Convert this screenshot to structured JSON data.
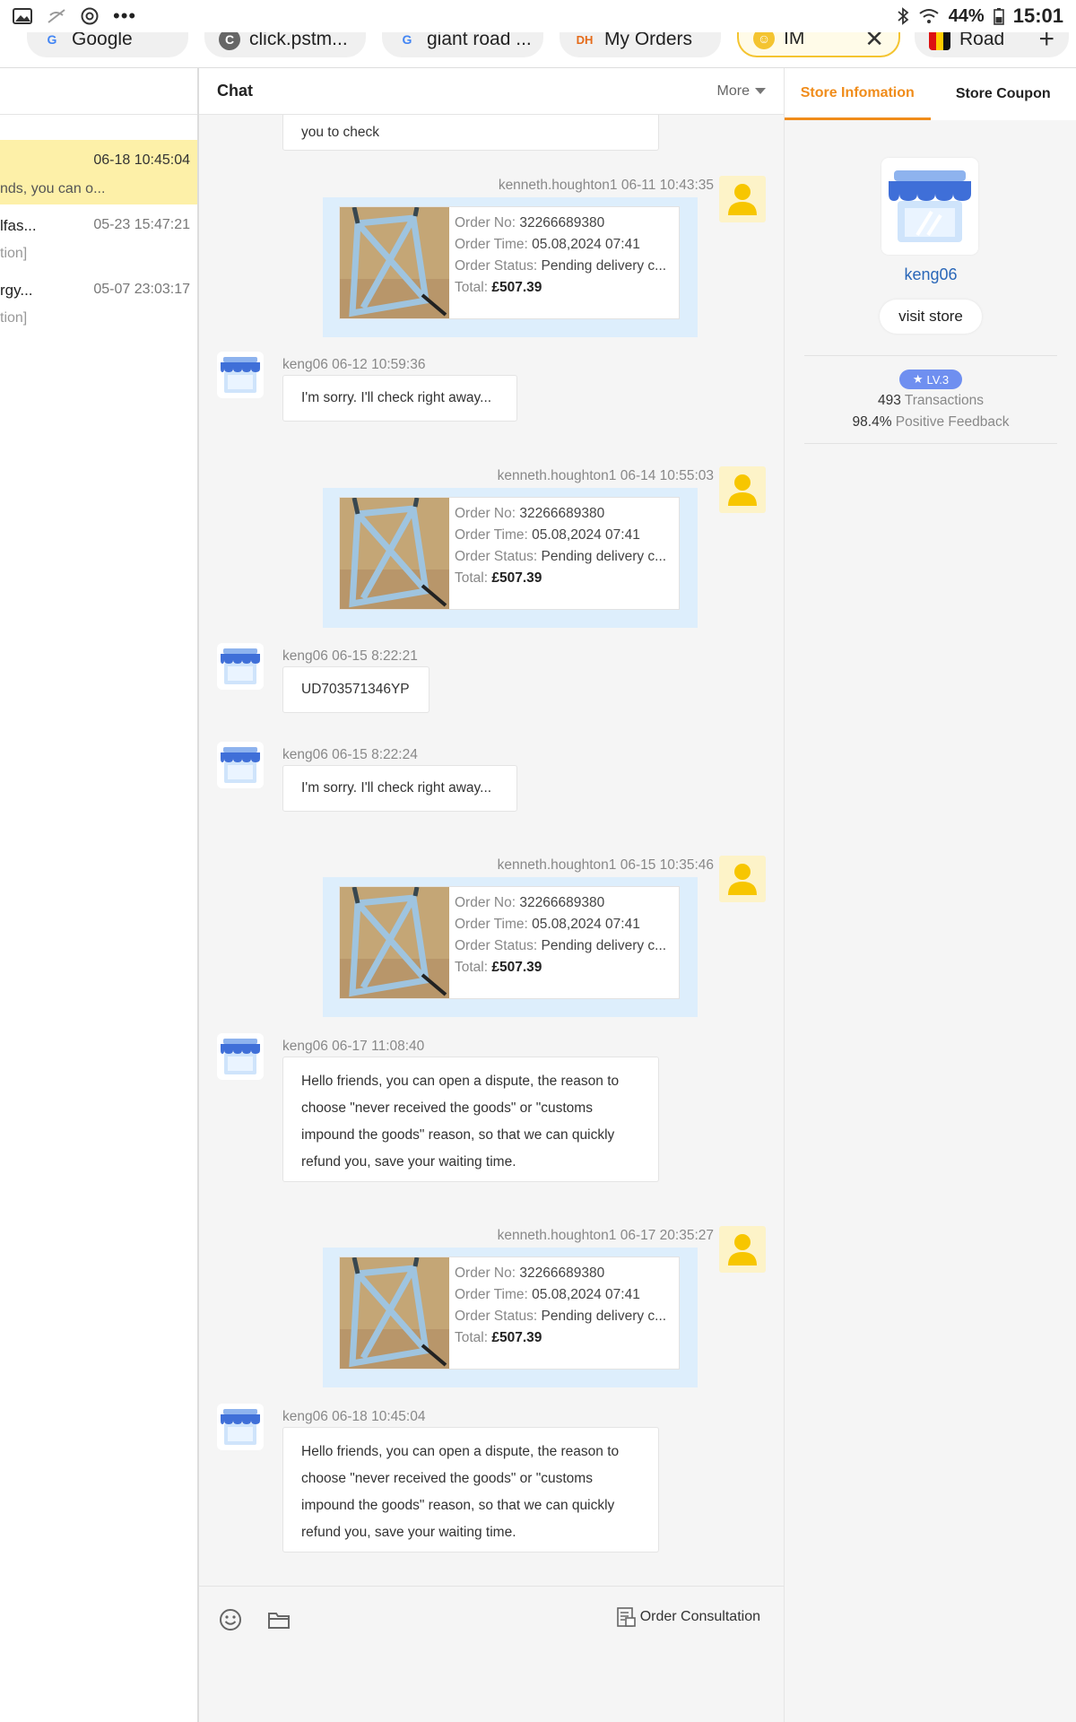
{
  "status_bar": {
    "battery": "44%",
    "time": "15:01"
  },
  "tabs": [
    {
      "label": "Google",
      "favicon": "google-g-icon"
    },
    {
      "label": "click.pstm...",
      "favicon": "click-icon"
    },
    {
      "label": "giant road ...",
      "favicon": "google-g-icon"
    },
    {
      "label": "My Orders",
      "favicon": "dh-icon"
    },
    {
      "label": "IM",
      "favicon": "im-icon",
      "active": true
    },
    {
      "label": "Road",
      "favicon": "flag-icon"
    }
  ],
  "conversations": [
    {
      "time": "06-18 10:45:04",
      "preview": "nds, you can o...",
      "active": true
    },
    {
      "name": "lfas...",
      "time": "05-23 15:47:21",
      "preview": "tion]"
    },
    {
      "name": "rgy...",
      "time": "05-07 23:03:17",
      "preview": "tion]"
    }
  ],
  "chat": {
    "title": "Chat",
    "more_label": "More",
    "first_bubble": "you to check",
    "orders": [
      {
        "meta": "kenneth.houghton1 06-11 10:43:35"
      },
      {
        "meta": "kenneth.houghton1 06-14 10:55:03"
      },
      {
        "meta": "kenneth.houghton1 06-15 10:35:46"
      },
      {
        "meta": "kenneth.houghton1 06-17 20:35:27"
      }
    ],
    "order_fields": {
      "no_label": "Order No:",
      "no": "32266689380",
      "time_label": "Order Time:",
      "time": "05.08,2024 07:41",
      "status_label": "Order Status:",
      "status": "Pending delivery c...",
      "total_label": "Total:",
      "total": "£507.39"
    },
    "store_msgs": [
      {
        "meta": "keng06 06-12 10:59:36",
        "text": "I'm sorry. I'll check right away..."
      },
      {
        "meta": "keng06 06-15 8:22:21",
        "text": "UD703571346YP"
      },
      {
        "meta": "keng06 06-15 8:22:24",
        "text": "I'm sorry. I'll check right away..."
      },
      {
        "meta": "keng06 06-17 11:08:40",
        "text": "Hello friends, you can open a dispute, the reason to choose \"never received the goods\" or \"customs impound the goods\" reason, so that we can quickly refund you, save your waiting time."
      },
      {
        "meta": "keng06 06-18 10:45:04",
        "text": "Hello friends, you can open a dispute, the reason to choose \"never received the goods\" or \"customs impound the goods\" reason, so that we can quickly refund you, save your waiting time."
      }
    ],
    "order_consultation": "Order Consultation"
  },
  "store": {
    "tab_info": "Store Infomation",
    "tab_coupon": "Store Coupon",
    "name": "keng06",
    "visit_label": "visit store",
    "level": "LV.3",
    "transactions_value": "493",
    "transactions_label": "Transactions",
    "feedback_value": "98.4%",
    "feedback_label": "Positive Feedback"
  },
  "colors": {
    "accent": "#f08c1a",
    "link": "#2a67b8",
    "highlight": "#fdf0a8",
    "order_bg": "#ddeefc"
  }
}
